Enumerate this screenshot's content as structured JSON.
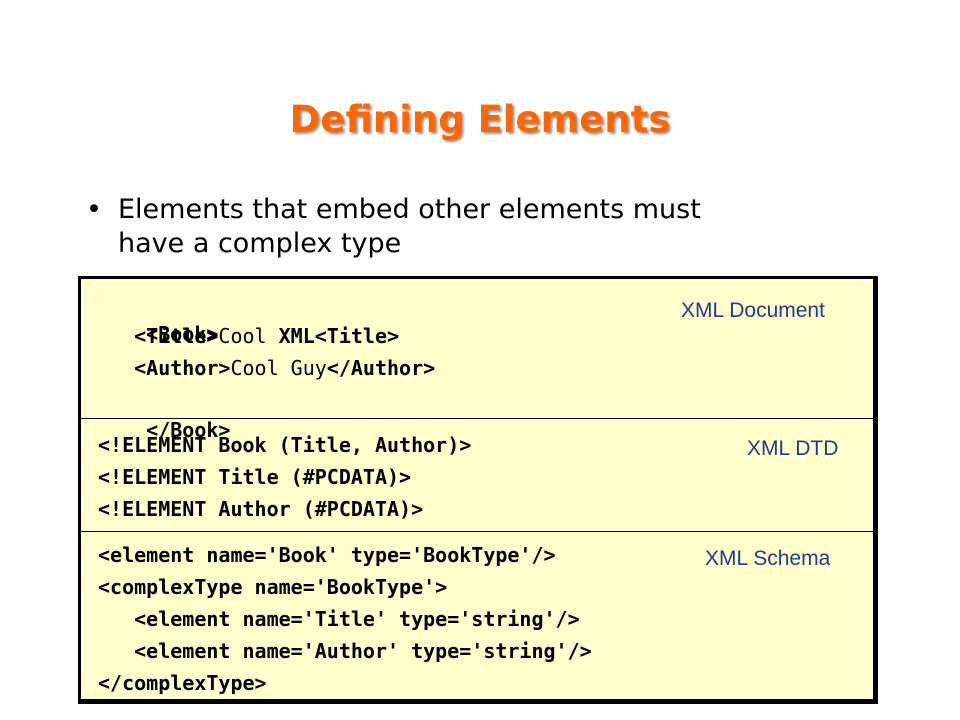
{
  "slide": {
    "title": "Defining Elements",
    "bullet": {
      "marker": "•",
      "text_line1": "Elements that embed other elements must",
      "text_line2": "have a complex type"
    }
  },
  "sections": {
    "document": {
      "label": "XML Document",
      "lines": [
        [
          "<Book>"
        ],
        [
          "   ",
          "<Title>",
          "Cool ",
          "XML",
          "<Title>"
        ],
        [
          "   ",
          "<Author>",
          "Cool Guy",
          "</Author>"
        ],
        [
          "</Book>"
        ]
      ]
    },
    "dtd": {
      "label": "XML DTD",
      "lines": [
        "<!ELEMENT Book (Title, Author)>",
        "<!ELEMENT Title (#PCDATA)>",
        "<!ELEMENT Author (#PCDATA)>"
      ]
    },
    "schema": {
      "label": "XML Schema",
      "lines": [
        "<element name='Book' type='BookType'/>",
        "<complexType name='BookType'>",
        "   <element name='Title' type='string'/>",
        "   <element name='Author' type='string'/>",
        "</complexType>"
      ]
    }
  }
}
